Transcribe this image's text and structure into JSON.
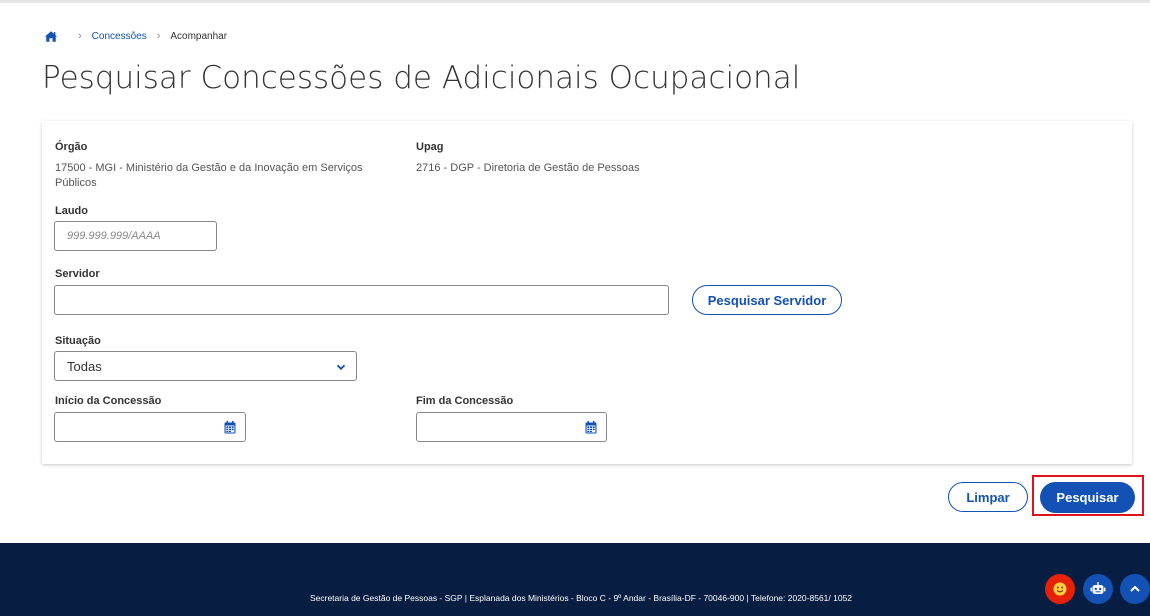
{
  "breadcrumb": {
    "home_icon": "home-icon",
    "items": [
      "Concessões",
      "Acompanhar"
    ]
  },
  "page": {
    "title": "Pesquisar Concessões de Adicionais Ocupacional"
  },
  "form": {
    "orgao": {
      "label": "Órgão",
      "value": "17500 - MGI - Ministério da Gestão e da Inovação em Serviços Públicos"
    },
    "upag": {
      "label": "Upag",
      "value": "2716 - DGP - Diretoria de Gestão de Pessoas"
    },
    "laudo": {
      "label": "Laudo",
      "placeholder": "999.999.999/AAAA",
      "value": ""
    },
    "servidor": {
      "label": "Servidor",
      "value": "",
      "button_label": "Pesquisar Servidor"
    },
    "situacao": {
      "label": "Situação",
      "selected": "Todas"
    },
    "inicio": {
      "label": "Início da Concessão",
      "value": ""
    },
    "fim": {
      "label": "Fim da Concessão",
      "value": ""
    }
  },
  "actions": {
    "clear_label": "Limpar",
    "search_label": "Pesquisar"
  },
  "footer": {
    "text": "Secretaria de Gestão de Pessoas - SGP | Esplanada dos Ministérios - Bloco C - 9º Andar - Brasília-DF - 70046-900 | Telefone: 2020-8561/ 1052"
  },
  "colors": {
    "primary": "#1351b4",
    "footer_bg": "#071d41",
    "highlight": "#e0121d",
    "fab_red": "#e52207"
  }
}
